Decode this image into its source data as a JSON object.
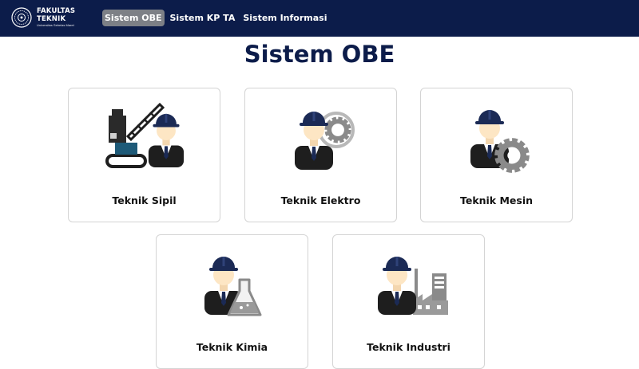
{
  "brand": {
    "line1": "FAKULTAS",
    "line2": "TEKNIK",
    "line3": "Universitas Sebelas Maret"
  },
  "nav": [
    {
      "label": "Sistem OBE",
      "active": true
    },
    {
      "label": "Sistem KP TA",
      "active": false
    },
    {
      "label": "Sistem Informasi",
      "active": false
    }
  ],
  "page_title": "Sistem OBE",
  "cards": [
    {
      "label": "Teknik Sipil",
      "icon": "civil-engineer-crane-icon"
    },
    {
      "label": "Teknik Elektro",
      "icon": "electrical-engineer-gear-icon"
    },
    {
      "label": "Teknik Mesin",
      "icon": "mechanical-engineer-gear-icon"
    },
    {
      "label": "Teknik Kimia",
      "icon": "chemical-engineer-flask-icon"
    },
    {
      "label": "Teknik Industri",
      "icon": "industrial-engineer-factory-icon"
    }
  ],
  "colors": {
    "navbar": "#0c1c4a",
    "active_tab": "#7d8086",
    "title": "#0c1c4a",
    "helmet": "#1b2a55",
    "skin": "#fde6c4",
    "suit": "#1e1e1e",
    "gear": "#8a8a8a"
  }
}
